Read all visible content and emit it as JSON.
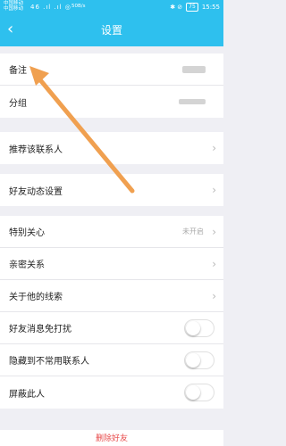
{
  "status_bar": {
    "carrier_line1": "中国移动",
    "carrier_line2": "中国移动",
    "signal": "46 .ıl .ıl ◎",
    "speed": "50B/s",
    "icons": "✱ ⊘",
    "battery": "75",
    "time": "15:55"
  },
  "nav": {
    "back_icon": "‹",
    "title": "设置"
  },
  "group1": [
    {
      "label": "备注",
      "value": ""
    },
    {
      "label": "分组",
      "value": ""
    }
  ],
  "group2": [
    {
      "label": "推荐该联系人"
    }
  ],
  "group3": [
    {
      "label": "好友动态设置"
    }
  ],
  "group4": [
    {
      "label": "特别关心",
      "value": "未开启"
    },
    {
      "label": "亲密关系"
    },
    {
      "label": "关于他的线索"
    },
    {
      "label": "好友消息免打扰",
      "toggle": false
    },
    {
      "label": "隐藏到不常用联系人",
      "toggle": false
    },
    {
      "label": "屏蔽此人",
      "toggle": false
    }
  ],
  "delete_label": "删除好友",
  "chevron": "›",
  "colors": {
    "header": "#2ec0ee",
    "annotation": "#f0a050",
    "delete_text": "#e84a4a"
  }
}
